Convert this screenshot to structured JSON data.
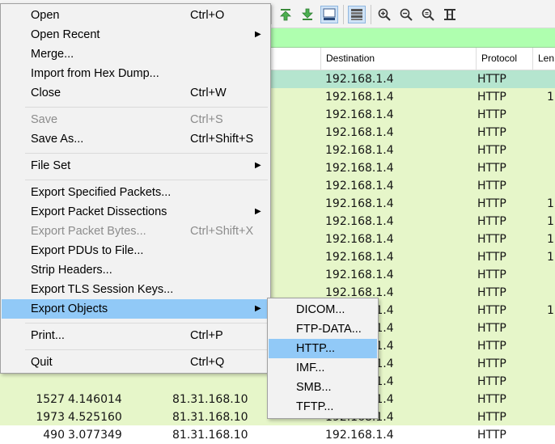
{
  "toolbar": {
    "icons": [
      "go-first-icon",
      "go-last-icon",
      "autoscroll-icon",
      "colorize-icon",
      "zoom-in-icon",
      "zoom-out-icon",
      "zoom-normal-icon",
      "resize-columns-icon"
    ]
  },
  "packet_list": {
    "columns": [
      "Destination",
      "Protocol",
      "Len"
    ],
    "rows": [
      {
        "no": "",
        "time": "",
        "source": "",
        "destination": "192.168.1.4",
        "protocol": "HTTP",
        "length": ""
      },
      {
        "no": "",
        "time": "",
        "source": "",
        "destination": "192.168.1.4",
        "protocol": "HTTP",
        "length": "1"
      },
      {
        "no": "",
        "time": "",
        "source": "",
        "destination": "192.168.1.4",
        "protocol": "HTTP",
        "length": ""
      },
      {
        "no": "",
        "time": "",
        "source": "",
        "destination": "192.168.1.4",
        "protocol": "HTTP",
        "length": ""
      },
      {
        "no": "",
        "time": "",
        "source": "",
        "destination": "192.168.1.4",
        "protocol": "HTTP",
        "length": ""
      },
      {
        "no": "",
        "time": "",
        "source": "",
        "destination": "192.168.1.4",
        "protocol": "HTTP",
        "length": ""
      },
      {
        "no": "",
        "time": "",
        "source": "",
        "destination": "192.168.1.4",
        "protocol": "HTTP",
        "length": ""
      },
      {
        "no": "",
        "time": "",
        "source": "",
        "destination": "192.168.1.4",
        "protocol": "HTTP",
        "length": "1"
      },
      {
        "no": "",
        "time": "",
        "source": "",
        "destination": "192.168.1.4",
        "protocol": "HTTP",
        "length": "1"
      },
      {
        "no": "",
        "time": "",
        "source": "",
        "destination": "192.168.1.4",
        "protocol": "HTTP",
        "length": "1"
      },
      {
        "no": "",
        "time": "",
        "source": "",
        "destination": "192.168.1.4",
        "protocol": "HTTP",
        "length": "1"
      },
      {
        "no": "",
        "time": "",
        "source": "",
        "destination": "192.168.1.4",
        "protocol": "HTTP",
        "length": ""
      },
      {
        "no": "",
        "time": "",
        "source": "",
        "destination": "192.168.1.4",
        "protocol": "HTTP",
        "length": ""
      },
      {
        "no": "",
        "time": "",
        "source": "",
        "destination": "192.168.1.4",
        "protocol": "HTTP",
        "length": "1"
      },
      {
        "no": "",
        "time": "",
        "source": "",
        "destination": "192.168.1.4",
        "protocol": "HTTP",
        "length": ""
      },
      {
        "no": "",
        "time": "",
        "source": "",
        "destination": "192.168.1.4",
        "protocol": "HTTP",
        "length": ""
      },
      {
        "no": "",
        "time": "",
        "source": "",
        "destination": "192.168.1.4",
        "protocol": "HTTP",
        "length": ""
      },
      {
        "no": "",
        "time": "",
        "source": "",
        "destination": "192.168.1.4",
        "protocol": "HTTP",
        "length": ""
      },
      {
        "no": "1527",
        "time": "4.146014",
        "source": "81.31.168.10",
        "destination": "192.168.1.4",
        "protocol": "HTTP",
        "length": ""
      },
      {
        "no": "1973",
        "time": "4.525160",
        "source": "81.31.168.10",
        "destination": "192.168.1.4",
        "protocol": "HTTP",
        "length": ""
      },
      {
        "no": "490",
        "time": "3.077349",
        "source": "81.31.168.10",
        "destination": "192.168.1.4",
        "protocol": "HTTP",
        "length": ""
      }
    ]
  },
  "file_menu": {
    "items": [
      {
        "label": "Open",
        "shortcut": "Ctrl+O"
      },
      {
        "label": "Open Recent",
        "submenu": true
      },
      {
        "label": "Merge..."
      },
      {
        "label": "Import from Hex Dump..."
      },
      {
        "label": "Close",
        "shortcut": "Ctrl+W"
      },
      {
        "label": "Save",
        "shortcut": "Ctrl+S",
        "disabled": true
      },
      {
        "label": "Save As...",
        "shortcut": "Ctrl+Shift+S"
      },
      {
        "label": "File Set",
        "submenu": true
      },
      {
        "label": "Export Specified Packets..."
      },
      {
        "label": "Export Packet Dissections",
        "submenu": true
      },
      {
        "label": "Export Packet Bytes...",
        "shortcut": "Ctrl+Shift+X",
        "disabled": true
      },
      {
        "label": "Export PDUs to File..."
      },
      {
        "label": "Strip Headers..."
      },
      {
        "label": "Export TLS Session Keys..."
      },
      {
        "label": "Export Objects",
        "submenu": true,
        "active": true
      },
      {
        "label": "Print...",
        "shortcut": "Ctrl+P"
      },
      {
        "label": "Quit",
        "shortcut": "Ctrl+Q"
      }
    ]
  },
  "export_objects_menu": {
    "items": [
      "DICOM...",
      "FTP-DATA...",
      "HTTP...",
      "IMF...",
      "SMB...",
      "TFTP..."
    ],
    "active_item": "HTTP..."
  },
  "colors": {
    "menu_highlight": "#91c9f7",
    "filter_bar": "#afffaf",
    "row_background": "#e6f6c9",
    "selected_row": "#b5e5cf",
    "disabled_text": "#8c8c8c"
  }
}
